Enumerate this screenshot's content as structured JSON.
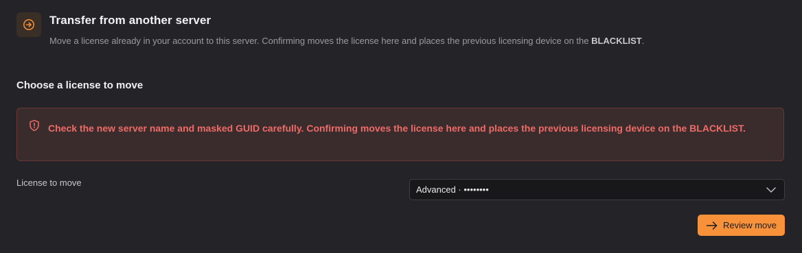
{
  "header": {
    "icon": "arrow-right-circle-icon",
    "title": "Transfer from another server",
    "description_prefix": "Move a license already in your account to this server. Confirming moves the license here and places the previous licensing device on the ",
    "description_emphasis": "BLACKLIST",
    "description_suffix": "."
  },
  "section": {
    "title": "Choose a license to move"
  },
  "alert": {
    "icon": "shield-alert-icon",
    "text": "Check the new server name and masked GUID carefully. Confirming moves the license here and places the previous licensing device on the BLACKLIST."
  },
  "license_field": {
    "label": "License to move",
    "selected_value": "Advanced · ••••••••",
    "chevron_icon": "chevron-down-icon"
  },
  "actions": {
    "review_label": "Review move",
    "review_icon": "arrow-right-icon"
  },
  "colors": {
    "background": "#242428",
    "accent": "#f7913a",
    "danger_text": "#ef6b68",
    "danger_bg": "#3a2b2c",
    "danger_border": "#6b3838"
  }
}
